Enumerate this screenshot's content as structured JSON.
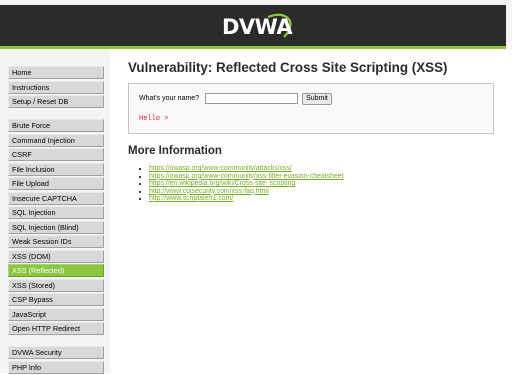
{
  "header": {
    "logo_text": "DVWA",
    "accent_color": "#8ac63f"
  },
  "sidebar": {
    "group1": [
      {
        "label": "Home"
      },
      {
        "label": "Instructions"
      },
      {
        "label": "Setup / Reset DB"
      }
    ],
    "group2": [
      {
        "label": "Brute Force"
      },
      {
        "label": "Command Injection"
      },
      {
        "label": "CSRF"
      },
      {
        "label": "File Inclusion"
      },
      {
        "label": "File Upload"
      },
      {
        "label": "Insecure CAPTCHA"
      },
      {
        "label": "SQL Injection"
      },
      {
        "label": "SQL Injection (Blind)"
      },
      {
        "label": "Weak Session IDs"
      },
      {
        "label": "XSS (DOM)"
      },
      {
        "label": "XSS (Reflected)",
        "active": true
      },
      {
        "label": "XSS (Stored)"
      },
      {
        "label": "CSP Bypass"
      },
      {
        "label": "JavaScript"
      },
      {
        "label": "Open HTTP Redirect"
      }
    ],
    "group3": [
      {
        "label": "DVWA Security"
      },
      {
        "label": "PHP Info"
      }
    ]
  },
  "main": {
    "title": "Vulnerability: Reflected Cross Site Scripting (XSS)",
    "form": {
      "label": "What's your name?",
      "input_value": "",
      "submit_label": "Submit",
      "output": "Hello >"
    },
    "more_info_heading": "More Information",
    "links": [
      "https://owasp.org/www-community/attacks/xss/",
      "https://owasp.org/www-community/xss-filter-evasion-cheatsheet",
      "https://en.wikipedia.org/wiki/Cross-site_scripting",
      "http://www.cgisecurity.com/xss-faq.html",
      "http://www.scriptalert1.com/"
    ]
  }
}
